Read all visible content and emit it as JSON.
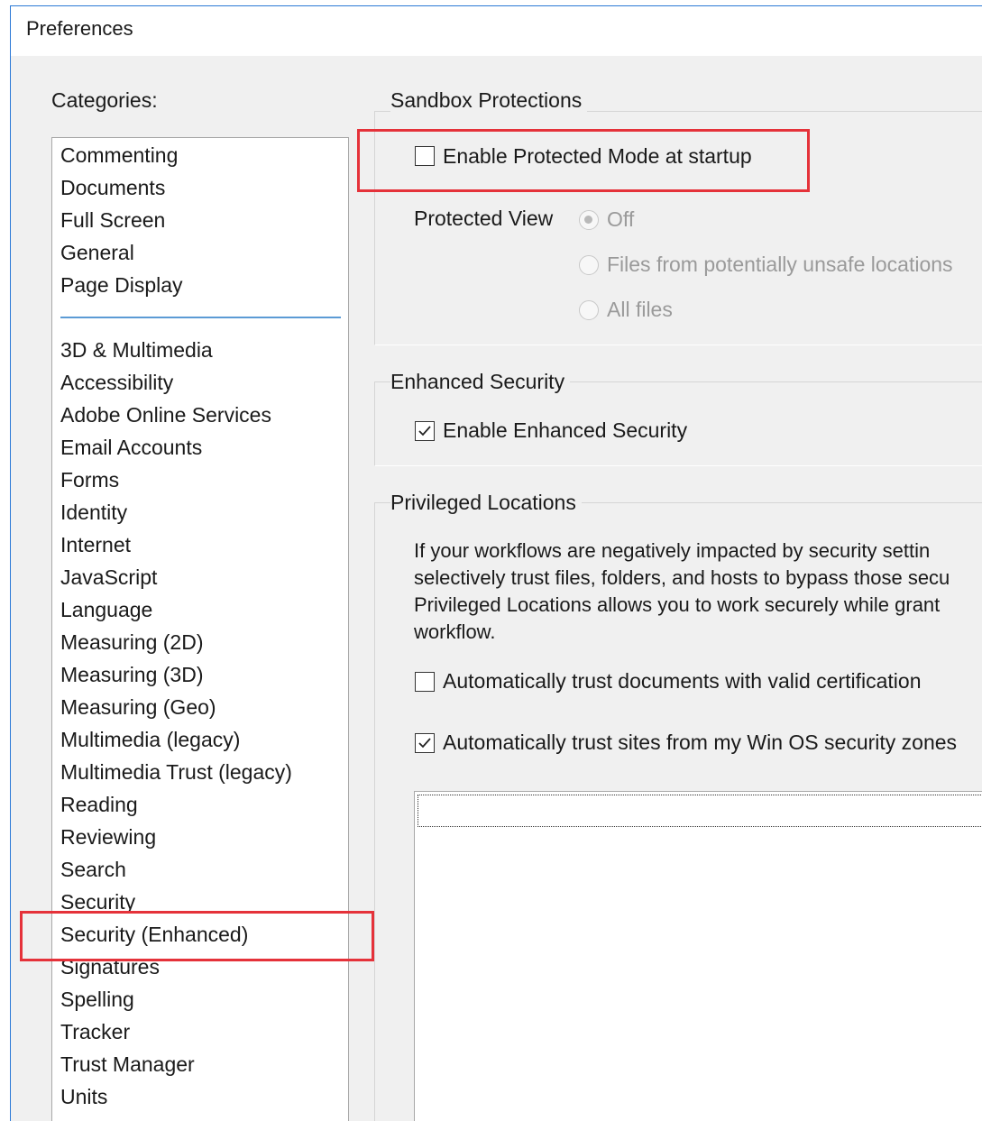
{
  "window": {
    "title": "Preferences"
  },
  "categories": {
    "label": "Categories:",
    "top_items": [
      "Commenting",
      "Documents",
      "Full Screen",
      "General",
      "Page Display"
    ],
    "items": [
      "3D & Multimedia",
      "Accessibility",
      "Adobe Online Services",
      "Email Accounts",
      "Forms",
      "Identity",
      "Internet",
      "JavaScript",
      "Language",
      "Measuring (2D)",
      "Measuring (3D)",
      "Measuring (Geo)",
      "Multimedia (legacy)",
      "Multimedia Trust (legacy)",
      "Reading",
      "Reviewing",
      "Search",
      "Security",
      "Security (Enhanced)",
      "Signatures",
      "Spelling",
      "Tracker",
      "Trust Manager",
      "Units"
    ],
    "selected": "Security (Enhanced)"
  },
  "sandbox": {
    "title": "Sandbox Protections",
    "protected_mode_label": "Enable Protected Mode at startup",
    "protected_mode_checked": false,
    "protected_view_label": "Protected View",
    "protected_view_options": [
      "Off",
      "Files from potentially unsafe locations",
      "All files"
    ],
    "protected_view_selected": "Off"
  },
  "enhanced": {
    "title": "Enhanced Security",
    "enable_label": "Enable Enhanced Security",
    "enable_checked": true
  },
  "privileged": {
    "title": "Privileged Locations",
    "description_lines": [
      "If your workflows are negatively impacted by security settin",
      "selectively trust files, folders, and hosts to bypass those secu",
      "Privileged Locations allows you to work securely while grant",
      "workflow."
    ],
    "trust_cert_label": "Automatically trust documents with valid certification",
    "trust_cert_checked": false,
    "trust_sites_label": "Automatically trust sites from my Win OS security zones",
    "trust_sites_checked": true
  },
  "colors": {
    "highlight": "#e5323a",
    "window_border": "#2b79d6",
    "separator": "#5b9bd5",
    "dialog_bg": "#f0f0f0"
  }
}
